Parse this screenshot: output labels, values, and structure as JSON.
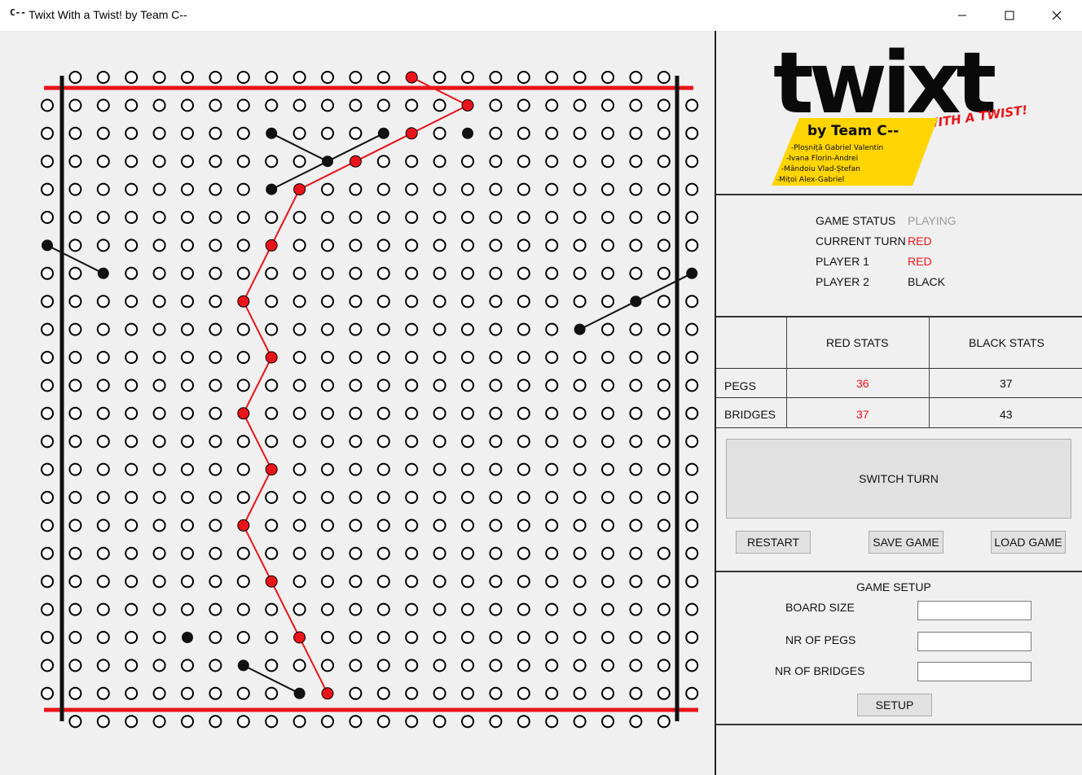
{
  "window": {
    "title": "Twixt With a Twist! by Team C--",
    "app_icon": "C--",
    "controls": [
      "minimize-icon",
      "maximize-icon",
      "close-icon"
    ]
  },
  "logo": {
    "word": "twixt",
    "tagline": "WITH A TWIST!",
    "team": "by Team C--",
    "members": [
      "-Ploșniță Gabriel Valentin",
      "-Ivana Florin-Andrei",
      "-Mândoiu Vlad-Ștefan",
      "-Mițoi Alex-Gabriel"
    ],
    "colors": {
      "tagline": "#e8141a",
      "badge": "#ffd500"
    }
  },
  "status": {
    "game_status_label": "GAME STATUS",
    "game_status_value": "PLAYING",
    "current_turn_label": "CURRENT TURN",
    "current_turn_value": "RED",
    "player1_label": "PLAYER 1",
    "player1_value": "RED",
    "player2_label": "PLAYER 2",
    "player2_value": "BLACK"
  },
  "stats": {
    "headers": [
      "RED STATS",
      "BLACK STATS"
    ],
    "rows": [
      {
        "label": "PEGS",
        "red": "36",
        "black": "37"
      },
      {
        "label": "BRIDGES",
        "red": "37",
        "black": "43"
      }
    ]
  },
  "actions": {
    "switch_turn": "SWITCH TURN",
    "restart": "RESTART",
    "save_game": "SAVE GAME",
    "load_game": "LOAD GAME"
  },
  "setup": {
    "title": "GAME SETUP",
    "board_size_label": "BOARD SIZE",
    "board_size_value": "",
    "pegs_label": "NR OF PEGS",
    "pegs_value": "",
    "bridges_label": "NR OF BRIDGES",
    "bridges_value": "",
    "setup_button": "SETUP"
  },
  "board": {
    "size": 24,
    "colors": {
      "red": "#e8141a",
      "black": "#111111",
      "empty_hole": "#ffffff"
    },
    "red_pegs": [
      [
        0,
        13
      ],
      [
        1,
        15
      ],
      [
        2,
        13
      ],
      [
        3,
        11
      ],
      [
        4,
        9
      ],
      [
        6,
        8
      ],
      [
        8,
        7
      ],
      [
        10,
        8
      ],
      [
        12,
        7
      ],
      [
        14,
        8
      ],
      [
        16,
        7
      ],
      [
        18,
        8
      ],
      [
        20,
        9
      ],
      [
        22,
        10
      ]
    ],
    "black_pegs": [
      [
        2,
        8
      ],
      [
        2,
        12
      ],
      [
        2,
        15
      ],
      [
        3,
        10
      ],
      [
        4,
        8
      ],
      [
        6,
        0
      ],
      [
        7,
        2
      ],
      [
        7,
        23
      ],
      [
        8,
        21
      ],
      [
        9,
        19
      ],
      [
        20,
        5
      ],
      [
        21,
        7
      ],
      [
        22,
        9
      ]
    ],
    "red_bridges": [
      [
        [
          0,
          13
        ],
        [
          1,
          15
        ]
      ],
      [
        [
          1,
          15
        ],
        [
          2,
          13
        ]
      ],
      [
        [
          2,
          13
        ],
        [
          3,
          11
        ]
      ],
      [
        [
          3,
          11
        ],
        [
          4,
          9
        ]
      ],
      [
        [
          4,
          9
        ],
        [
          6,
          8
        ]
      ],
      [
        [
          6,
          8
        ],
        [
          8,
          7
        ]
      ],
      [
        [
          8,
          7
        ],
        [
          10,
          8
        ]
      ],
      [
        [
          10,
          8
        ],
        [
          12,
          7
        ]
      ],
      [
        [
          12,
          7
        ],
        [
          14,
          8
        ]
      ],
      [
        [
          14,
          8
        ],
        [
          16,
          7
        ]
      ],
      [
        [
          16,
          7
        ],
        [
          18,
          8
        ]
      ],
      [
        [
          18,
          8
        ],
        [
          20,
          9
        ]
      ],
      [
        [
          20,
          9
        ],
        [
          22,
          10
        ]
      ]
    ],
    "black_bridges": [
      [
        [
          2,
          8
        ],
        [
          3,
          10
        ]
      ],
      [
        [
          2,
          12
        ],
        [
          3,
          10
        ]
      ],
      [
        [
          3,
          10
        ],
        [
          4,
          8
        ]
      ],
      [
        [
          6,
          0
        ],
        [
          7,
          2
        ]
      ],
      [
        [
          7,
          23
        ],
        [
          8,
          21
        ]
      ],
      [
        [
          8,
          21
        ],
        [
          9,
          19
        ]
      ],
      [
        [
          21,
          7
        ],
        [
          22,
          9
        ]
      ]
    ]
  }
}
